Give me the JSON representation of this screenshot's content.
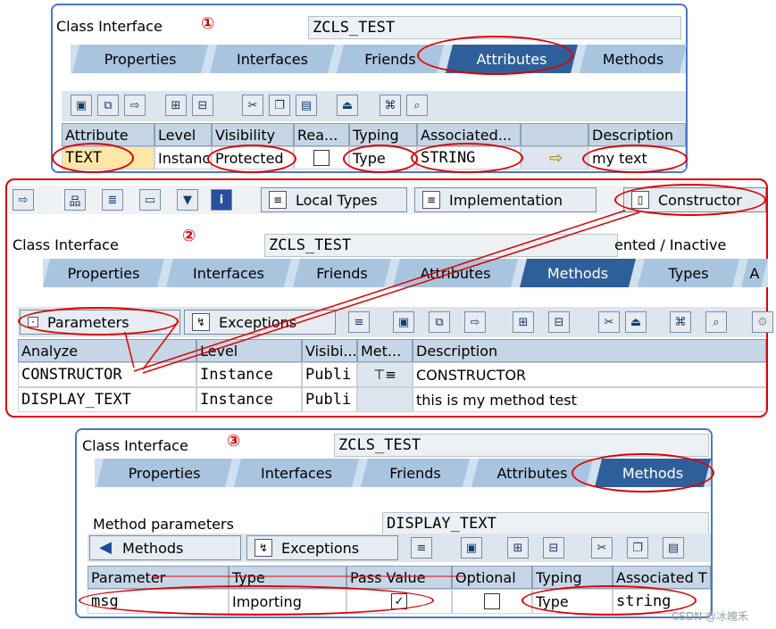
{
  "panel1": {
    "class_label": "Class Interface",
    "class_value": "ZCLS_TEST",
    "marker": "①",
    "tabs": [
      "Properties",
      "Interfaces",
      "Friends",
      "Attributes",
      "Methods"
    ],
    "active_tab": "Attributes",
    "columns": [
      "Attribute",
      "Level",
      "Visibility",
      "Rea...",
      "Typing",
      "Associated...",
      "",
      "Description"
    ],
    "row": {
      "attribute": "TEXT",
      "level": "Instanc",
      "visibility": "Protected",
      "readonly": false,
      "typing": "Type",
      "associated": "STRING",
      "arrow": "⇨",
      "description": "my text"
    }
  },
  "panel2": {
    "buttons": {
      "local_types": "Local Types",
      "implementation": "Implementation",
      "constructor": "Constructor",
      "parameters": "Parameters",
      "exceptions": "Exceptions"
    },
    "class_label": "Class Interface",
    "class_value": "ZCLS_TEST",
    "status": "ented / Inactive",
    "marker": "②",
    "tabs": [
      "Properties",
      "Interfaces",
      "Friends",
      "Attributes",
      "Methods",
      "Types",
      "A"
    ],
    "active_tab": "Methods",
    "columns": [
      "Analyze",
      "Level",
      "Visibi...",
      "Met...",
      "Description"
    ],
    "rows": [
      {
        "method": "CONSTRUCTOR",
        "level": "Instance",
        "visibility": "Publi",
        "icon": "⊤≡",
        "description": "CONSTRUCTOR"
      },
      {
        "method": "DISPLAY_TEXT",
        "level": "Instance",
        "visibility": "Publi",
        "icon": "",
        "description": "this is my method test"
      }
    ]
  },
  "panel3": {
    "class_label": "Class Interface",
    "class_value": "ZCLS_TEST",
    "marker": "③",
    "tabs": [
      "Properties",
      "Interfaces",
      "Friends",
      "Attributes",
      "Methods"
    ],
    "active_tab": "Methods",
    "method_params_label": "Method parameters",
    "method_params_value": "DISPLAY_TEXT",
    "buttons": {
      "methods": "Methods",
      "exceptions": "Exceptions"
    },
    "columns": [
      "Parameter",
      "Type",
      "Pass Value",
      "Optional",
      "Typing",
      "Associated T"
    ],
    "row": {
      "parameter": "msg",
      "type": "Importing",
      "pass_value": true,
      "optional": false,
      "typing": "Type",
      "associated": "string"
    }
  },
  "watermark": "CSDN @冰魄禾",
  "colors": {
    "accent": "#2f5f9a",
    "tab": "#a9c4df",
    "highlight": "#e00000",
    "border": "#4a78c8"
  }
}
